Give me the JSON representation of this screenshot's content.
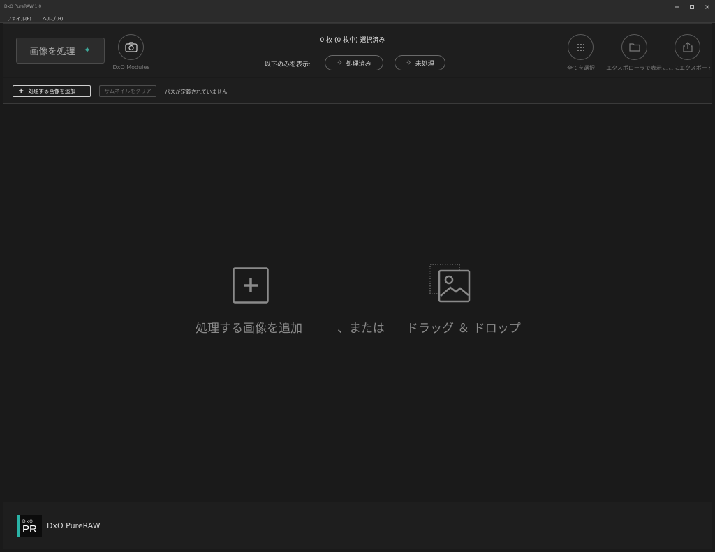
{
  "window": {
    "title": "DxO PureRAW 1.0"
  },
  "menu": [
    "ファイル(F)",
    "ヘルプ(H)"
  ],
  "toolbar": {
    "process_label": "画像を処理",
    "modules_label": "DxO Modules",
    "selection_count": "0 枚 (0 枚中) 選択済み",
    "filter_label": "以下のみを表示:",
    "filter_processed": "処理済み",
    "filter_unprocessed": "未処理",
    "select_all": "全てを選択",
    "show_in_explorer": "エクスポローラで表示",
    "export_here": "ここにエクスポート..."
  },
  "subbar": {
    "add_label": "処理する画像を追加",
    "clear_label": "サムネイルをクリア",
    "path_status": "パスが定義されていません"
  },
  "dropzone": {
    "add_text": "処理する画像を追加",
    "or_text": "、または",
    "drag_text": "ドラッグ ＆ ドロップ"
  },
  "footer": {
    "logo_small": "DxO",
    "logo_main": "PR",
    "app_name": "DxO PureRAW"
  },
  "colors": {
    "accent": "#2ab3a7",
    "background": "#1a1a1a",
    "panel": "#1e1e1e"
  }
}
